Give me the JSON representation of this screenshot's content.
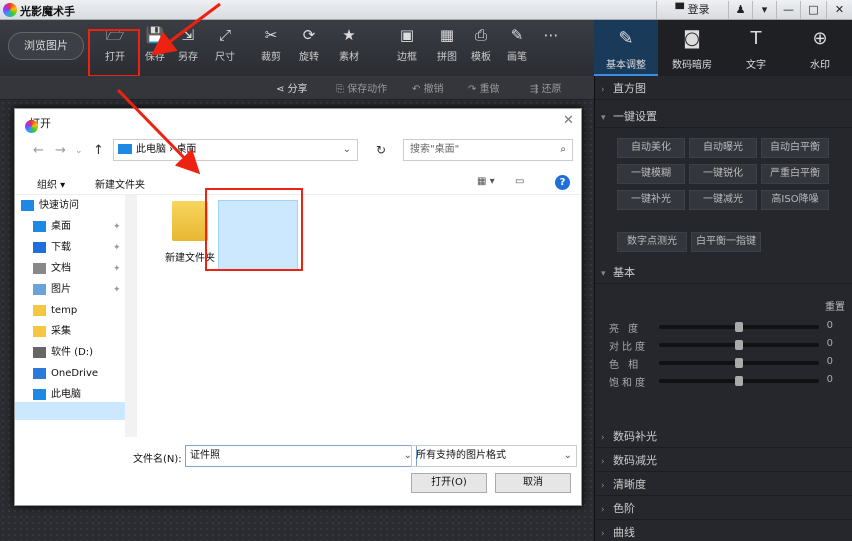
{
  "app": {
    "title": "光影魔术手"
  },
  "titlebar": {
    "login": "登录",
    "btns": [
      "▾",
      "—",
      "□",
      "✕"
    ]
  },
  "toolbar": {
    "browse": "浏览图片",
    "tools": [
      {
        "icon": "🗁",
        "label": "打开"
      },
      {
        "icon": "💾",
        "label": "保存"
      },
      {
        "icon": "⇲",
        "label": "另存"
      },
      {
        "icon": "⤢",
        "label": "尺寸"
      },
      {
        "icon": "✂",
        "label": "裁剪"
      },
      {
        "icon": "⟳",
        "label": "旋转"
      },
      {
        "icon": "★",
        "label": "素材"
      },
      {
        "icon": "▣",
        "label": "边框"
      },
      {
        "icon": "▦",
        "label": "拼图"
      },
      {
        "icon": "⎙",
        "label": "模板"
      },
      {
        "icon": "✎",
        "label": "画笔"
      },
      {
        "icon": "⋯",
        "label": ""
      }
    ]
  },
  "rtabs": [
    {
      "icon": "✎",
      "label": "基本调整"
    },
    {
      "icon": "◙",
      "label": "数码暗房"
    },
    {
      "icon": "T",
      "label": "文字"
    },
    {
      "icon": "⊕",
      "label": "水印"
    }
  ],
  "actions": {
    "share": "分享",
    "save_action": "保存动作",
    "undo": "撤销",
    "redo": "重做",
    "restore": "还原"
  },
  "dialog": {
    "title": "打开",
    "address": "此电脑 › 桌面",
    "search_placeholder": "搜索\"桌面\"",
    "organize": "组织 ▾",
    "new_folder": "新建文件夹",
    "nav_items": [
      {
        "label": "快速访问",
        "pin": false
      },
      {
        "label": "桌面",
        "pin": true
      },
      {
        "label": "下载",
        "pin": true
      },
      {
        "label": "文档",
        "pin": true
      },
      {
        "label": "图片",
        "pin": true
      },
      {
        "label": "temp",
        "pin": false
      },
      {
        "label": "采集",
        "pin": false
      },
      {
        "label": "软件 (D:)",
        "pin": false
      },
      {
        "label": "OneDrive",
        "pin": false
      },
      {
        "label": "此电脑",
        "pin": false
      }
    ],
    "files": [
      {
        "name": "新建文件夹",
        "type": "folder"
      },
      {
        "name": "证件照",
        "type": "image"
      }
    ],
    "filename_label": "文件名(N):",
    "filename_value": "证件照",
    "filetype": "所有支持的图片格式",
    "open_btn": "打开(O)",
    "cancel_btn": "取消"
  },
  "rpanel": {
    "histogram": "直方图",
    "oneclick": "一键设置",
    "btn_row1": [
      "自动美化",
      "自动曝光",
      "自动白平衡"
    ],
    "btn_row2": [
      "一键模糊",
      "一键锐化",
      "严重白平衡"
    ],
    "btn_row3": [
      "一键补光",
      "一键减光",
      "高ISO降噪"
    ],
    "btn_row4": [
      "数字点测光",
      "白平衡一指键"
    ],
    "basic": "基本",
    "reset": "重置",
    "sliders": [
      {
        "label": "亮 度",
        "value": "0",
        "level": 0.5
      },
      {
        "label": "对比度",
        "value": "0",
        "level": 0.5
      },
      {
        "label": "色 相",
        "value": "0",
        "level": 0.5
      },
      {
        "label": "饱和度",
        "value": "0",
        "level": 0.5
      }
    ],
    "collapsed": [
      "数码补光",
      "数码减光",
      "清晰度",
      "色阶",
      "曲线"
    ]
  }
}
